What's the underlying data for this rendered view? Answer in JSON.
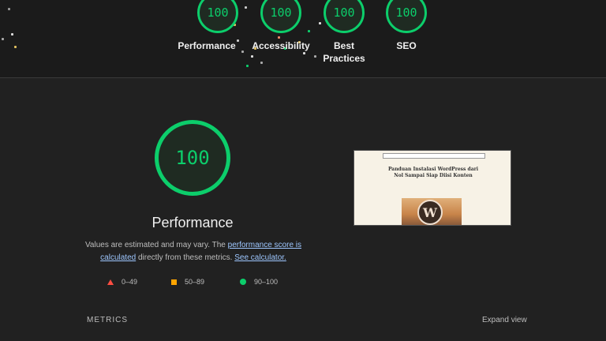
{
  "summary": {
    "gauges": [
      {
        "score": "100",
        "label": "Performance"
      },
      {
        "score": "100",
        "label": "Accessibility"
      },
      {
        "score": "100",
        "label": "Best Practices"
      },
      {
        "score": "100",
        "label": "SEO"
      }
    ]
  },
  "performance": {
    "score": "100",
    "title": "Performance",
    "desc_prefix": "Values are estimated and may vary. The ",
    "link_score": "performance score is calculated",
    "desc_middle": " directly from these metrics. ",
    "link_calc": "See calculator.",
    "legend": [
      {
        "range": "0–49",
        "color": "#ff4e42",
        "shape": "triangle"
      },
      {
        "range": "50–89",
        "color": "#ffa400",
        "shape": "square"
      },
      {
        "range": "90–100",
        "color": "#0cce6b",
        "shape": "circle"
      }
    ]
  },
  "thumbnail": {
    "title": "Panduan Instalasi WordPress dari Nol Sampai Siap Diisi Konten",
    "logo_letter": "W"
  },
  "metrics": {
    "label": "METRICS",
    "expand_label": "Expand view"
  },
  "colors": {
    "pass": "#0cce6b",
    "average": "#ffa400",
    "fail": "#ff4e42",
    "background": "#212121"
  }
}
